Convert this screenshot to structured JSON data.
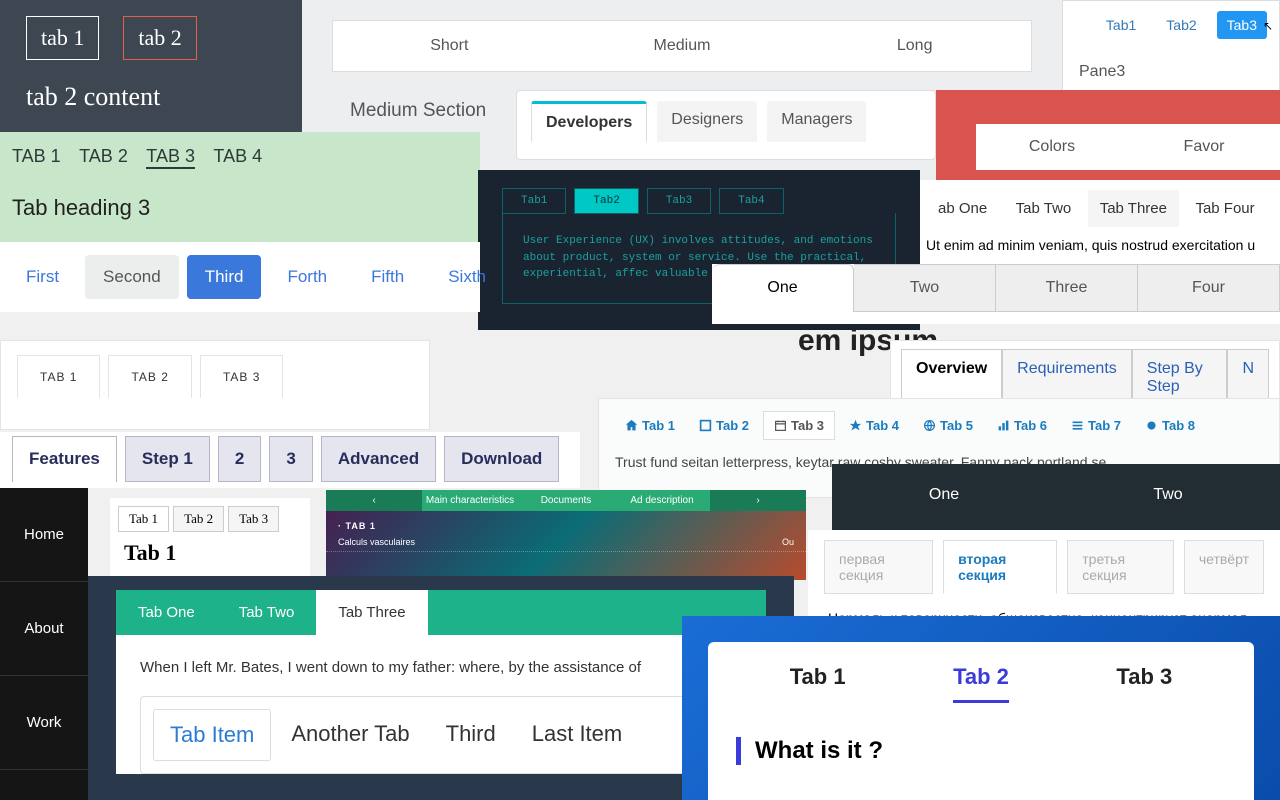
{
  "A": {
    "t1": "tab 1",
    "t2": "tab 2",
    "content": "tab 2 content"
  },
  "B": {
    "t1": "Short",
    "t2": "Medium",
    "t3": "Long",
    "title": "Medium Section"
  },
  "C": {
    "t1": "Tab1",
    "t2": "Tab2",
    "t3": "Tab3",
    "pane": "Pane3"
  },
  "D": {
    "t1": "Developers",
    "t2": "Designers",
    "t3": "Managers"
  },
  "E": {
    "t1": "TAB 1",
    "t2": "TAB 2",
    "t3": "TAB 3",
    "t4": "TAB 4",
    "h": "Tab heading 3"
  },
  "F": {
    "t1": "Colors",
    "t2": "Favor"
  },
  "G": {
    "t1": "Tab1",
    "t2": "Tab2",
    "t3": "Tab3",
    "t4": "Tab4",
    "body": "User Experience (UX) involves attitudes, and emotions about product, system or service. Use the practical, experiential, affec valuable aspects of human-com"
  },
  "H": {
    "t1": "First",
    "t2": "Second",
    "t3": "Third",
    "t4": "Forth",
    "t5": "Fifth",
    "t6": "Sixth"
  },
  "I": {
    "t1": "ab One",
    "t2": "Tab Two",
    "t3": "Tab Three",
    "t4": "Tab Four",
    "txt": "Ut enim ad minim veniam, quis nostrud exercitation u"
  },
  "J": {
    "t1": "One",
    "t2": "Two",
    "t3": "Three",
    "t4": "Four"
  },
  "K": {
    "t1": "TAB 1",
    "t2": "TAB 2",
    "t3": "TAB 3"
  },
  "L": {
    "t1": "Overview",
    "t2": "Requirements",
    "t3": "Step By Step",
    "t4": "N"
  },
  "M": "em ipsum",
  "N": {
    "t1": "Tab 1",
    "t2": "Tab 2",
    "t3": "Tab 3",
    "t4": "Tab 4",
    "t5": "Tab 5",
    "t6": "Tab 6",
    "t7": "Tab 7",
    "t8": "Tab 8",
    "body": "Trust fund seitan letterpress, keytar raw cosby sweater. Fanny pack portland se"
  },
  "O": {
    "t1": "Features",
    "t2": "Step 1",
    "t3": "2",
    "t4": "3",
    "t5": "Advanced",
    "t6": "Download"
  },
  "P": {
    "t1": "One",
    "t2": "Two"
  },
  "Q": {
    "t1": "Tab 1",
    "t2": "Tab 2",
    "t3": "Tab 3",
    "h": "Tab 1"
  },
  "R": {
    "t1": "Main characteristics",
    "t2": "Documents",
    "t3": "Ad description",
    "sub": "· TAB 1",
    "row": "Calculs vasculaires",
    "row2": "Ou"
  },
  "S": {
    "t1": "первая секция",
    "t2": "вторая секция",
    "t3": "третья секция",
    "t4": "четвёрт",
    "txt": "Нормаль к поверхности, общеизвестно, концентрирует анормал"
  },
  "T": {
    "i1": "Home",
    "i2": "About",
    "i3": "Work"
  },
  "U": {
    "t1": "Tab One",
    "t2": "Tab Two",
    "t3": "Tab Three",
    "txt": "When I left Mr. Bates, I went down to my father: where, by the assistance of "
  },
  "V": {
    "t1": "Tab Item",
    "t2": "Another Tab",
    "t3": "Third",
    "t4": "Last Item"
  },
  "W": {
    "t1": "Tab 1",
    "t2": "Tab 2",
    "t3": "Tab 3",
    "h": "What is it ?"
  }
}
